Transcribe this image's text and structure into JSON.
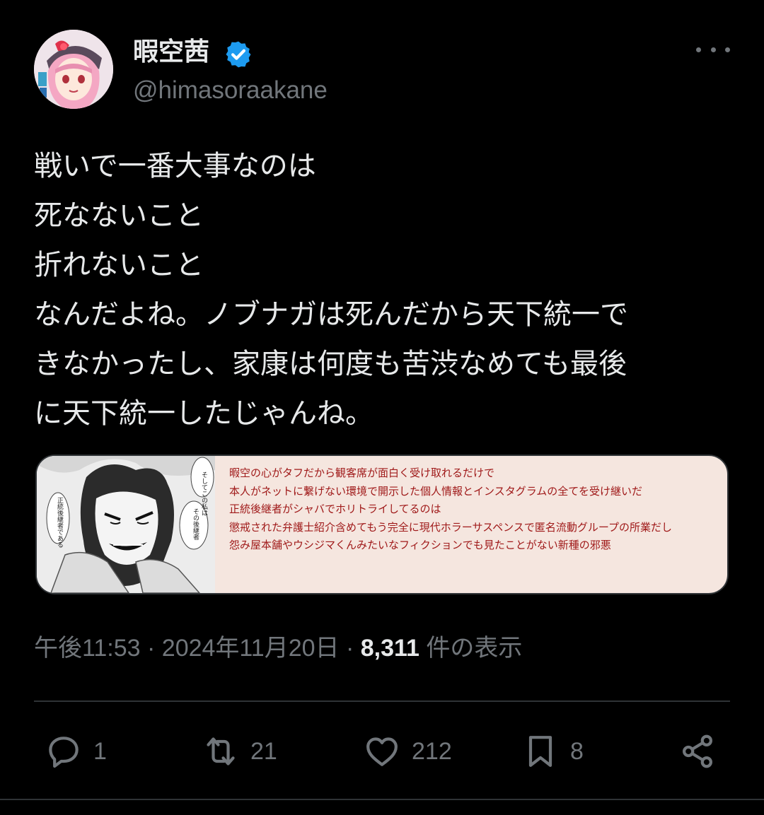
{
  "author": {
    "display_name": "暇空茜",
    "handle": "@himasoraakane",
    "verified": true,
    "avatar_icon": "avatar-image"
  },
  "tweet": {
    "lines": [
      "戦いで一番大事なのは",
      "死なないこと",
      "折れないこと",
      "なんだよね。ノブナガは死んだから天下統一で",
      "きなかったし、家康は何度も苦渋なめても最後",
      "に天下統一したじゃんね。"
    ]
  },
  "media": {
    "manga_texts": {
      "bubble1": "そしてこの私は",
      "bubble2": "その後継者",
      "bubble3": "正統後継者である"
    },
    "lines": [
      "暇空の心がタフだから観客席が面白く受け取れるだけで",
      "本人がネットに繋げない環境で開示した個人情報とインスタグラムの全てを受け継いだ",
      "正統後継者がシャバでホリトライしてるのは",
      "懲戒された弁護士紹介含めてもう完全に現代ホラーサスペンスで匿名流動グループの所業だし",
      "怨み屋本舗やウシジマくんみたいなフィクションでも見たことがない新種の邪悪"
    ]
  },
  "meta": {
    "time": "午後11:53",
    "separator": " · ",
    "date": "2024年11月20日",
    "views_count": "8,311",
    "views_label": " 件の表示"
  },
  "actions": {
    "reply_count": "1",
    "retweet_count": "21",
    "like_count": "212",
    "bookmark_count": "8"
  },
  "colors": {
    "background": "#000000",
    "text": "#e7e9ea",
    "muted": "#71767b",
    "verified": "#1d9bf0",
    "divider": "#2f3336",
    "media_bg": "#f5e6df",
    "media_text": "#a01a1a"
  }
}
